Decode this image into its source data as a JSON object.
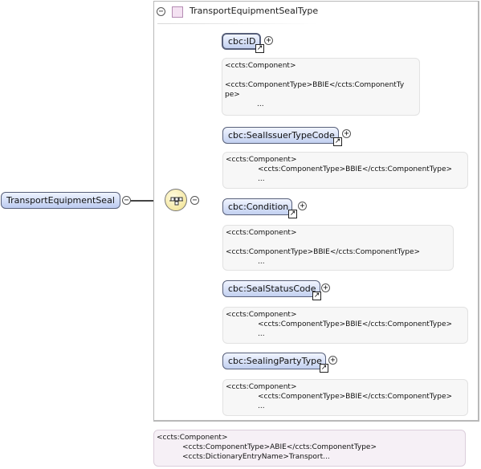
{
  "type": {
    "title": "TransportEquipmentSealType",
    "toggle_symbol": "−"
  },
  "root": {
    "label": "TransportEquipmentSeal",
    "toggle_symbol": "−"
  },
  "sequence": {
    "toggle_symbol": "−",
    "icon": "sequence-compositor-icon"
  },
  "elements": [
    {
      "label": "cbc:ID",
      "required": true,
      "note": [
        "<ccts:Component>",
        "",
        "<ccts:ComponentType>BBIE</ccts:ComponentTy",
        "pe>",
        "..."
      ]
    },
    {
      "label": "cbc:SealIssuerTypeCode",
      "required": false,
      "note": [
        "<ccts:Component>",
        "<ccts:ComponentType>BBIE</ccts:ComponentType>",
        "..."
      ]
    },
    {
      "label": "cbc:Condition",
      "required": false,
      "note": [
        "<ccts:Component>",
        "",
        "<ccts:ComponentType>BBIE</ccts:ComponentType>",
        "..."
      ]
    },
    {
      "label": "cbc:SealStatusCode",
      "required": false,
      "note": [
        "<ccts:Component>",
        "<ccts:ComponentType>BBIE</ccts:ComponentType>",
        "..."
      ]
    },
    {
      "label": "cbc:SealingPartyType",
      "required": false,
      "note": [
        "<ccts:Component>",
        "<ccts:ComponentType>BBIE</ccts:ComponentType>",
        "..."
      ]
    }
  ],
  "type_note": [
    "<ccts:Component>",
    "<ccts:ComponentType>ABIE</ccts:ComponentType>",
    "<ccts:DictionaryEntryName>Transport..."
  ],
  "expand_symbol": "+",
  "link_symbol": "↗"
}
